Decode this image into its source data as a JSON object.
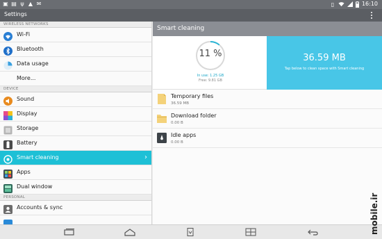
{
  "status_bar": {
    "time": "16:10",
    "left_icons": [
      "notification-icon",
      "gallery-icon",
      "usb-icon",
      "android-icon",
      "mail-icon"
    ],
    "right_icons": [
      "vibrate-icon",
      "wifi-icon",
      "signal-icon",
      "battery-icon"
    ]
  },
  "action_bar": {
    "title": "Settings"
  },
  "sidebar": {
    "sections": [
      {
        "header": "WIRELESS NETWORKS",
        "items": [
          {
            "label": "Wi-Fi",
            "icon": "wifi-icon",
            "color": "#2a7fd4"
          },
          {
            "label": "Bluetooth",
            "icon": "bluetooth-icon",
            "color": "#1f6fc9"
          },
          {
            "label": "Data usage",
            "icon": "data-usage-icon",
            "color": "#3aa0e0"
          },
          {
            "label": "More...",
            "icon": "",
            "color": ""
          }
        ]
      },
      {
        "header": "DEVICE",
        "items": [
          {
            "label": "Sound",
            "icon": "sound-icon",
            "color": "#e88a1e"
          },
          {
            "label": "Display",
            "icon": "display-icon",
            "color": "#8a4fd0"
          },
          {
            "label": "Storage",
            "icon": "storage-icon",
            "color": "#9a9a9a"
          },
          {
            "label": "Battery",
            "icon": "battery-icon",
            "color": "#4a4a4a"
          },
          {
            "label": "Smart cleaning",
            "icon": "smart-cleaning-icon",
            "color": "#ffffff",
            "selected": true
          },
          {
            "label": "Apps",
            "icon": "apps-icon",
            "color": "#3d8a4e"
          },
          {
            "label": "Dual window",
            "icon": "dual-window-icon",
            "color": "#3b9a6a"
          }
        ]
      },
      {
        "header": "PERSONAL",
        "items": [
          {
            "label": "Accounts & sync",
            "icon": "accounts-sync-icon",
            "color": "#6b6b6b"
          },
          {
            "label": "",
            "icon": "cloud-icon",
            "color": "#2a8ad8"
          }
        ]
      }
    ]
  },
  "detail": {
    "title": "Smart cleaning",
    "usage_percent_text": "11 %",
    "usage_fraction": 0.11,
    "in_use": "In use: 1.25 GB",
    "free": "Free: 9.81 GB",
    "clean_size": "36.59 MB",
    "clean_hint": "Tap below to clean space with Smart cleaning",
    "items": [
      {
        "name": "Temporary files",
        "size": "36.59 MB",
        "icon": "temporary-files-icon"
      },
      {
        "name": "Download folder",
        "size": "0.00 B",
        "icon": "folder-icon"
      },
      {
        "name": "Idle apps",
        "size": "0.00 B",
        "icon": "idle-apps-icon"
      }
    ]
  },
  "nav_bar": {
    "buttons": [
      "recent-apps-icon",
      "home-icon",
      "notifications-pull-icon",
      "dual-window-nav-icon",
      "back-icon"
    ]
  },
  "watermark": "mobile.ir",
  "colors": {
    "accent": "#1ec0d6",
    "clean_panel": "#48c6e7",
    "action_bar": "#5b5e63",
    "detail_header": "#8b8e94"
  }
}
